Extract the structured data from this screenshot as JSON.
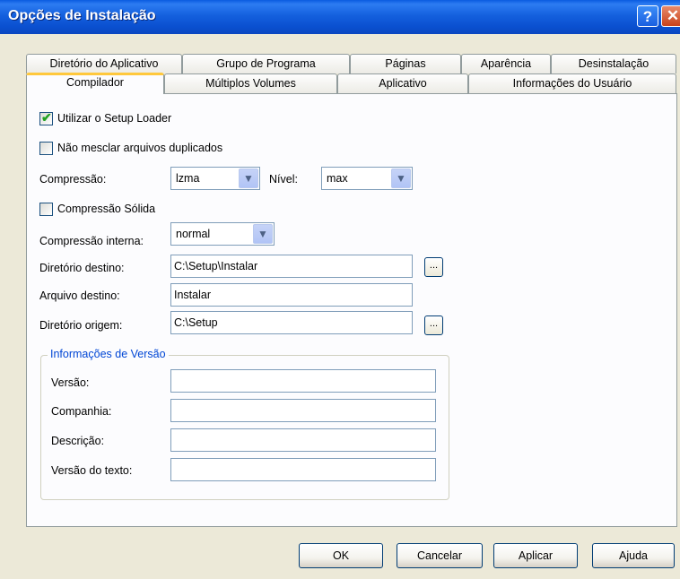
{
  "window": {
    "title": "Opções de Instalação",
    "help_glyph": "?",
    "close_glyph": "✕"
  },
  "tabs_row1": [
    "Diretório do Aplicativo",
    "Grupo de Programa",
    "Páginas",
    "Aparência",
    "Desinstalação"
  ],
  "tabs_row2": [
    "Compilador",
    "Múltiplos Volumes",
    "Aplicativo",
    "Informações do Usuário"
  ],
  "active_tab": "Compilador",
  "form": {
    "use_setup_loader": {
      "label": "Utilizar o Setup Loader",
      "checked": true
    },
    "no_merge_duplicates": {
      "label": "Não mesclar arquivos duplicados",
      "checked": false
    },
    "compression_label": "Compressão:",
    "compression_value": "lzma",
    "level_label": "Nível:",
    "level_value": "max",
    "solid_compression": {
      "label": "Compressão Sólida",
      "checked": false
    },
    "internal_compression_label": "Compressão interna:",
    "internal_compression_value": "normal",
    "dest_dir_label": "Diretório destino:",
    "dest_dir_value": "C:\\Setup\\Instalar",
    "dest_file_label": "Arquivo destino:",
    "dest_file_value": "Instalar",
    "source_dir_label": "Diretório origem:",
    "source_dir_value": "C:\\Setup",
    "browse_label": "..."
  },
  "version_info": {
    "title": "Informações de Versão",
    "version_label": "Versão:",
    "company_label": "Companhia:",
    "description_label": "Descrição:",
    "text_version_label": "Versão do texto:",
    "version_value": "",
    "company_value": "",
    "description_value": "",
    "text_version_value": ""
  },
  "buttons": {
    "ok": "OK",
    "cancel": "Cancelar",
    "apply": "Aplicar",
    "help": "Ajuda"
  },
  "icons": {
    "checkbox_check": "check-icon",
    "dropdown": "chevron-down-icon"
  },
  "colors": {
    "titlebar": "#0a5ce0",
    "tab_highlight": "#ffc83c",
    "group_title": "#0046d5",
    "checkmark": "#21a121"
  }
}
